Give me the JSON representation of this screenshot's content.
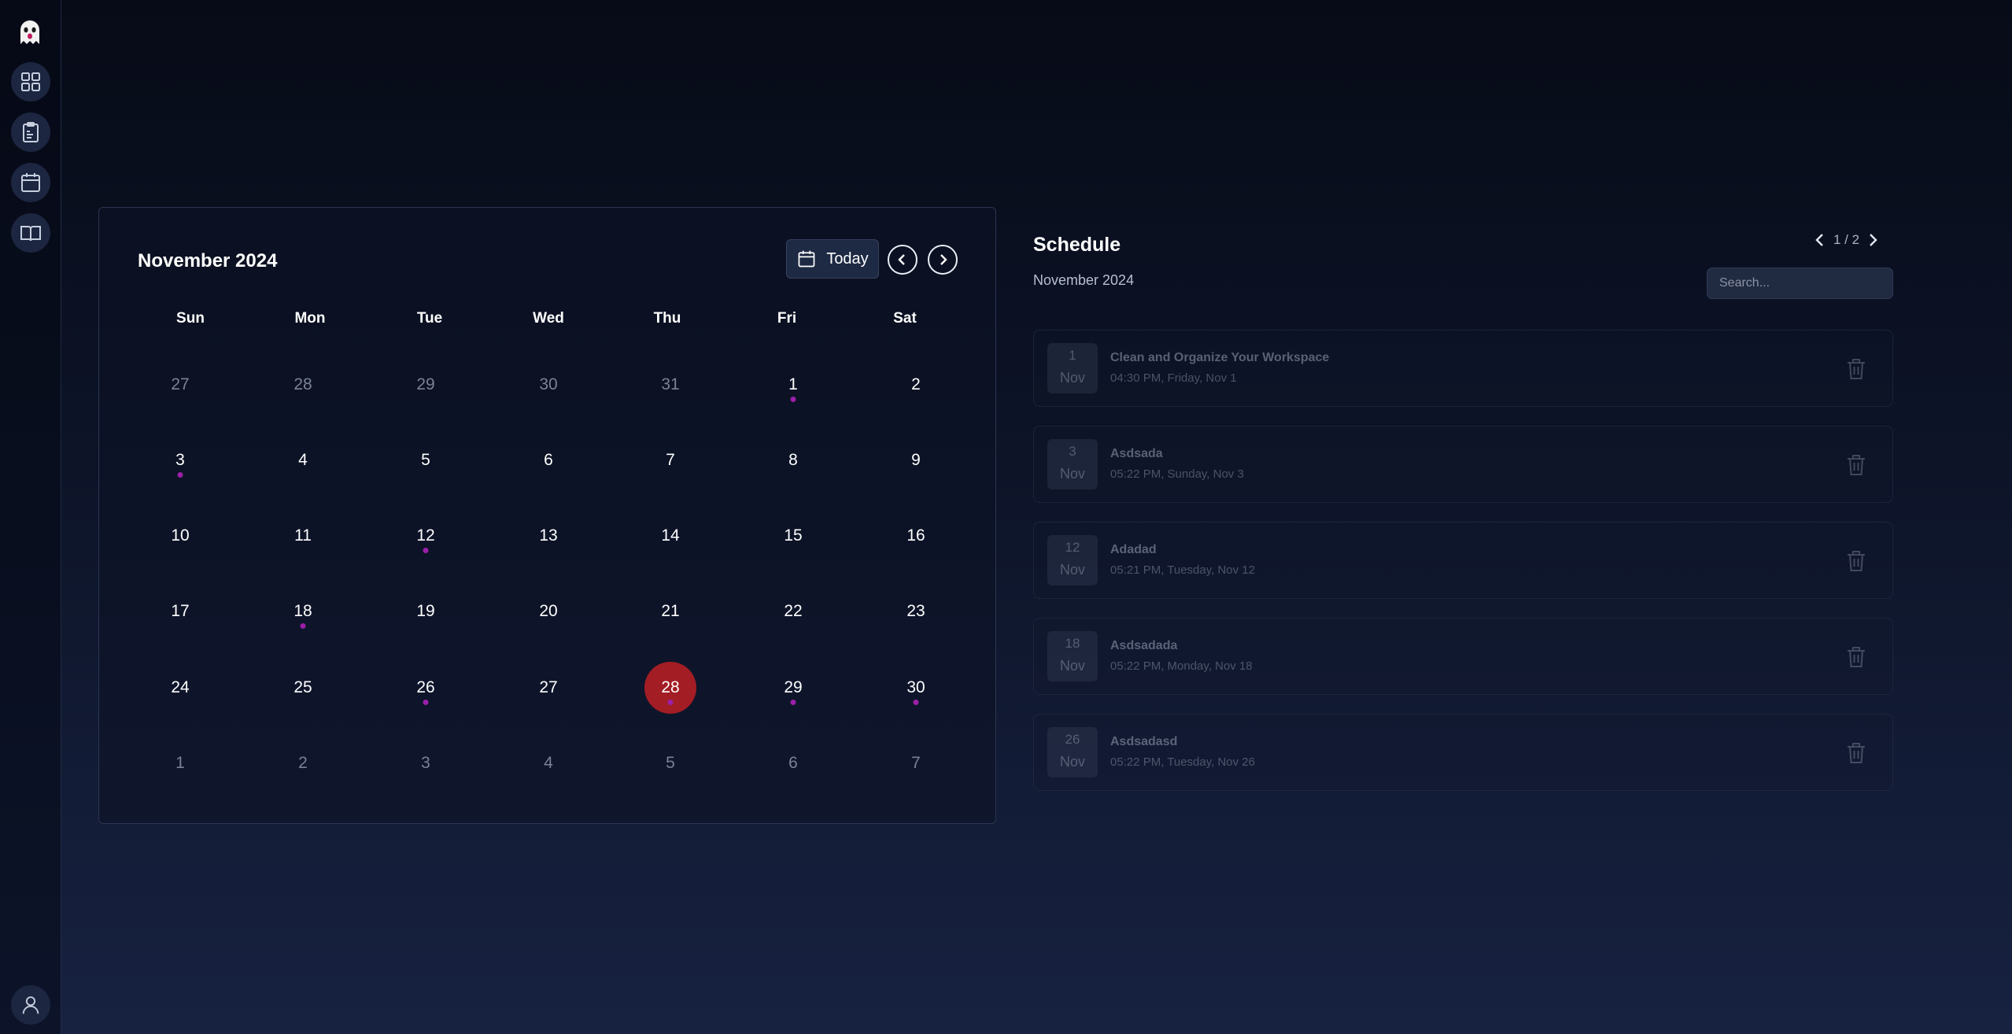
{
  "sidebar": {
    "items": [
      {
        "icon": "ghost-logo-icon"
      },
      {
        "icon": "grid-dashboard-icon"
      },
      {
        "icon": "clipboard-notes-icon"
      },
      {
        "icon": "calendar-icon"
      },
      {
        "icon": "open-book-icon"
      }
    ],
    "bottom_icon": "user-icon"
  },
  "calendar": {
    "title": "November 2024",
    "today_label": "Today",
    "weekdays": [
      "Sun",
      "Mon",
      "Tue",
      "Wed",
      "Thu",
      "Fri",
      "Sat"
    ],
    "weeks": [
      [
        {
          "d": "27",
          "muted": true
        },
        {
          "d": "28",
          "muted": true
        },
        {
          "d": "29",
          "muted": true
        },
        {
          "d": "30",
          "muted": true
        },
        {
          "d": "31",
          "muted": true
        },
        {
          "d": "1",
          "dot": true
        },
        {
          "d": "2"
        }
      ],
      [
        {
          "d": "3",
          "dot": true
        },
        {
          "d": "4"
        },
        {
          "d": "5"
        },
        {
          "d": "6"
        },
        {
          "d": "7"
        },
        {
          "d": "8"
        },
        {
          "d": "9"
        }
      ],
      [
        {
          "d": "10"
        },
        {
          "d": "11"
        },
        {
          "d": "12",
          "dot": true
        },
        {
          "d": "13"
        },
        {
          "d": "14"
        },
        {
          "d": "15"
        },
        {
          "d": "16"
        }
      ],
      [
        {
          "d": "17"
        },
        {
          "d": "18",
          "dot": true
        },
        {
          "d": "19"
        },
        {
          "d": "20"
        },
        {
          "d": "21"
        },
        {
          "d": "22"
        },
        {
          "d": "23"
        }
      ],
      [
        {
          "d": "24"
        },
        {
          "d": "25"
        },
        {
          "d": "26",
          "dot": true
        },
        {
          "d": "27"
        },
        {
          "d": "28",
          "today": true,
          "dot": true
        },
        {
          "d": "29",
          "dot": true
        },
        {
          "d": "30",
          "dot": true
        }
      ],
      [
        {
          "d": "1",
          "muted": true
        },
        {
          "d": "2",
          "muted": true
        },
        {
          "d": "3",
          "muted": true
        },
        {
          "d": "4",
          "muted": true
        },
        {
          "d": "5",
          "muted": true
        },
        {
          "d": "6",
          "muted": true
        },
        {
          "d": "7",
          "muted": true
        }
      ]
    ],
    "colors": {
      "today": "#a31d24",
      "event_dot": "#9b1fa8"
    }
  },
  "schedule": {
    "title": "Schedule",
    "subtitle": "November 2024",
    "pager": "1 / 2",
    "search_placeholder": "Search...",
    "events": [
      {
        "day": "1",
        "month": "Nov",
        "title": "Clean and Organize Your Workspace",
        "time": "04:30 PM, Friday, Nov 1"
      },
      {
        "day": "3",
        "month": "Nov",
        "title": "Asdsada",
        "time": "05:22 PM, Sunday, Nov 3"
      },
      {
        "day": "12",
        "month": "Nov",
        "title": "Adadad",
        "time": "05:21 PM, Tuesday, Nov 12"
      },
      {
        "day": "18",
        "month": "Nov",
        "title": "Asdsadada",
        "time": "05:22 PM, Monday, Nov 18"
      },
      {
        "day": "26",
        "month": "Nov",
        "title": "Asdsadasd",
        "time": "05:22 PM, Tuesday, Nov 26"
      }
    ]
  }
}
